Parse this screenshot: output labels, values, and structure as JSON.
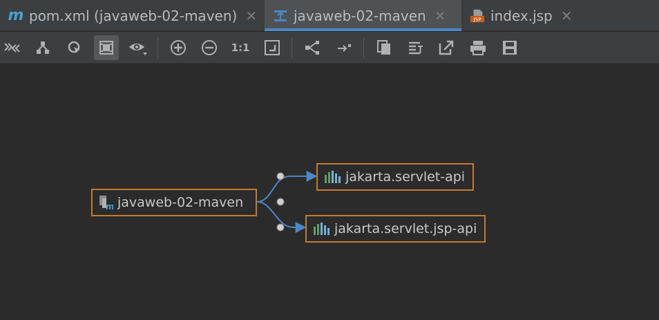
{
  "tabs": [
    {
      "label": "pom.xml (javaweb-02-maven)",
      "icon": "maven-m-icon",
      "active": false
    },
    {
      "label": "javaweb-02-maven",
      "icon": "diagram-icon",
      "active": true
    },
    {
      "label": "index.jsp",
      "icon": "jsp-file-icon",
      "active": false
    }
  ],
  "tab_icon_text": {
    "maven": "m",
    "jsp": "JSP"
  },
  "toolbar": {
    "buttons": [
      "collapse-expand-icon",
      "hierarchy-icon",
      "select-icon",
      "fit-content-icon",
      "visibility-icon",
      "zoom-in-icon",
      "zoom-out-icon",
      "actual-size-icon",
      "fit-page-icon",
      "layout-icon",
      "route-edges-icon",
      "copy-icon",
      "export-text-icon",
      "export-icon",
      "print-icon",
      "save-icon"
    ],
    "actual_size_label": "1:1",
    "pressed": "fit-content-icon"
  },
  "diagram": {
    "root": {
      "label": "javaweb-02-maven"
    },
    "deps": [
      {
        "label": "jakarta.servlet-api"
      },
      {
        "label": "jakarta.servlet.jsp-api"
      }
    ]
  },
  "colors": {
    "node_border": "#c57b2e",
    "edge": "#4a88c7",
    "accent": "#4a88c7"
  }
}
